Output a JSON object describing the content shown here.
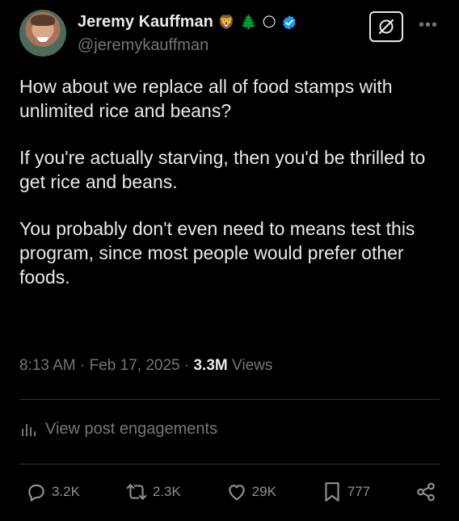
{
  "author": {
    "name": "Jeremy Kauffman",
    "handle": "@jeremykauffman",
    "emojis": [
      "🦁",
      "🌲",
      "🌕"
    ]
  },
  "post": {
    "paragraphs": [
      "How about we replace all of food stamps with unlimited rice and beans?",
      "If you're actually starving, then you'd be thrilled to get rice and beans.",
      "You probably don't even need to means test this program, since most people would prefer other foods."
    ],
    "time": "8:13 AM",
    "separator": " · ",
    "date": "Feb 17, 2025",
    "views_count": "3.3M",
    "views_label": " Views"
  },
  "engagements_label": "View post engagements",
  "actions": {
    "replies": "3.2K",
    "reposts": "2.3K",
    "likes": "29K",
    "bookmarks": "777"
  },
  "colors": {
    "background": "#000000",
    "text": "#e7e9ea",
    "secondary": "#71767b",
    "verified": "#1d9bf0"
  },
  "icons": [
    "grok-icon",
    "more-icon",
    "verified-icon",
    "engagements-icon",
    "reply-icon",
    "repost-icon",
    "like-icon",
    "bookmark-icon",
    "share-icon"
  ]
}
